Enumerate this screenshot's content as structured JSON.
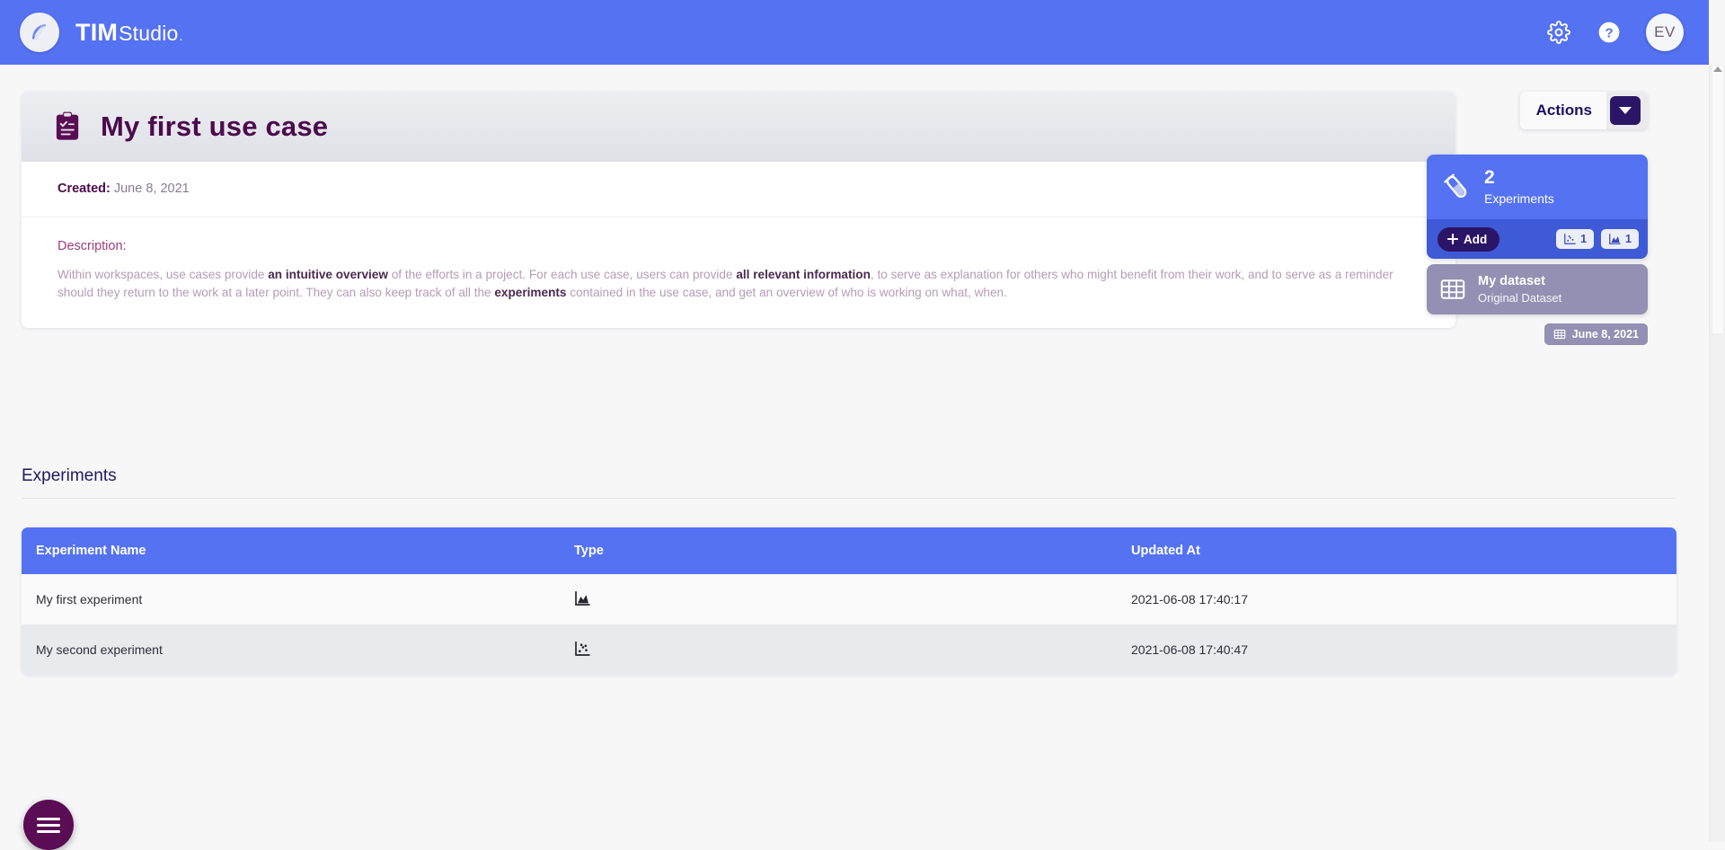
{
  "brand": {
    "part1": "TIM",
    "part2": "Studio",
    "part3": ".",
    "logo_icon": "tim-leaf-icon"
  },
  "topbar": {
    "settings_icon": "gear-icon",
    "help_icon": "question-circle-icon",
    "avatar_initials": "EV"
  },
  "usecase": {
    "icon": "clipboard-check-icon",
    "title": "My first use case",
    "created_label": "Created:",
    "created_value": "June 8, 2021",
    "description_label": "Description:",
    "description_parts": [
      {
        "text": "Within workspaces, use cases provide ",
        "bold": false
      },
      {
        "text": "an intuitive overview",
        "bold": true
      },
      {
        "text": " of the efforts in a project. For each use case, users can provide ",
        "bold": false
      },
      {
        "text": "all relevant information",
        "bold": true
      },
      {
        "text": ", to serve as explanation for others who might benefit from their work, and to serve as a reminder should they return to the work at a later point. They can also keep track of all the ",
        "bold": false
      },
      {
        "text": "experiments",
        "bold": true
      },
      {
        "text": " contained in the use case, and get an overview of who is working on what, when.",
        "bold": false
      }
    ]
  },
  "actions": {
    "label": "Actions",
    "caret_icon": "chevron-down-icon"
  },
  "experiments_card": {
    "icon": "test-tube-icon",
    "count": "2",
    "label": "Experiments",
    "add_label": "Add",
    "add_icon": "plus-icon",
    "badges": [
      {
        "icon": "scatter-chart-icon",
        "value": "1"
      },
      {
        "icon": "area-chart-icon",
        "value": "1"
      }
    ]
  },
  "dataset_card": {
    "icon": "table-grid-icon",
    "name": "My dataset",
    "subtitle": "Original Dataset",
    "date_icon": "calendar-table-icon",
    "date": "June 8, 2021"
  },
  "experiments_section": {
    "title": "Experiments",
    "columns": [
      "Experiment Name",
      "Type",
      "Updated At"
    ],
    "rows": [
      {
        "name": "My first experiment",
        "type_icon": "area-chart-icon",
        "updated_at": "2021-06-08 17:40:17"
      },
      {
        "name": "My second experiment",
        "type_icon": "scatter-chart-icon",
        "updated_at": "2021-06-08 17:40:47"
      }
    ]
  },
  "fab": {
    "icon": "hamburger-menu-icon"
  },
  "colors": {
    "brand_blue": "#5472f2",
    "dark_purple": "#4d0a4d",
    "indigo": "#2b1566",
    "dataset_purple": "#9390b3",
    "fab_purple": "#5a0c54"
  }
}
